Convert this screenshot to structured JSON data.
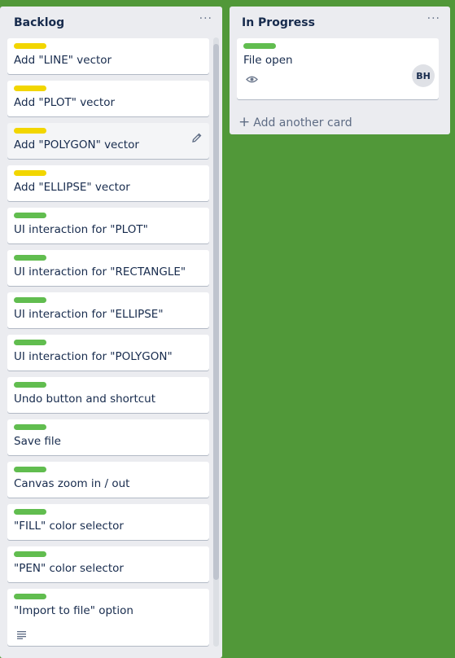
{
  "colors": {
    "board_bg": "#519839",
    "label_yellow": "#f2d600",
    "label_green": "#61bd4f"
  },
  "lists": {
    "backlog": {
      "title": "Backlog",
      "menu": "···",
      "cards": [
        {
          "title": "Add \"LINE\" vector",
          "label": "yellow"
        },
        {
          "title": "Add \"PLOT\" vector",
          "label": "yellow"
        },
        {
          "title": "Add \"POLYGON\" vector",
          "label": "yellow",
          "hovered": true
        },
        {
          "title": "Add \"ELLIPSE\" vector",
          "label": "yellow"
        },
        {
          "title": "UI interaction for \"PLOT\"",
          "label": "green"
        },
        {
          "title": "UI interaction for \"RECTANGLE\"",
          "label": "green"
        },
        {
          "title": "UI interaction for \"ELLIPSE\"",
          "label": "green"
        },
        {
          "title": "UI interaction for \"POLYGON\"",
          "label": "green"
        },
        {
          "title": "Undo button and shortcut",
          "label": "green"
        },
        {
          "title": "Save file",
          "label": "green"
        },
        {
          "title": "Canvas zoom in / out",
          "label": "green"
        },
        {
          "title": "\"FILL\" color selector",
          "label": "green"
        },
        {
          "title": "\"PEN\" color selector",
          "label": "green"
        },
        {
          "title": "\"Import to file\" option",
          "label": "green",
          "has_description": true
        }
      ]
    },
    "in_progress": {
      "title": "In Progress",
      "menu": "···",
      "cards": [
        {
          "title": "File open",
          "label": "green",
          "watching": true,
          "member": "BH"
        }
      ],
      "add_card": "Add another card"
    }
  }
}
